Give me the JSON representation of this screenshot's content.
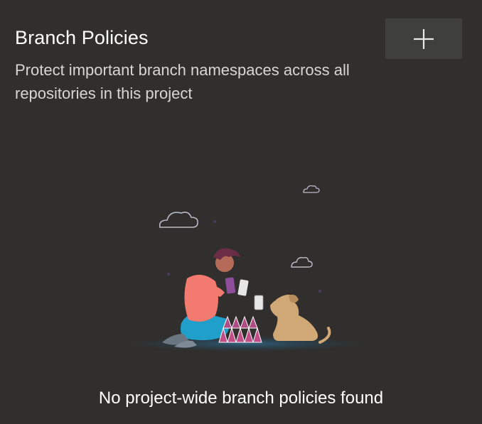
{
  "header": {
    "title": "Branch Policies",
    "subtitle": "Protect important branch namespaces across all repositories in this project",
    "add_button_icon": "plus-icon"
  },
  "empty_state": {
    "illustration_icon": "person-building-card-house-with-dog-illustration",
    "message": "No project-wide branch policies found"
  },
  "colors": {
    "background": "#302f2d",
    "button_background": "#3f3f3e",
    "title_text": "#ffffff",
    "subtitle_text": "#d6d6d6"
  }
}
